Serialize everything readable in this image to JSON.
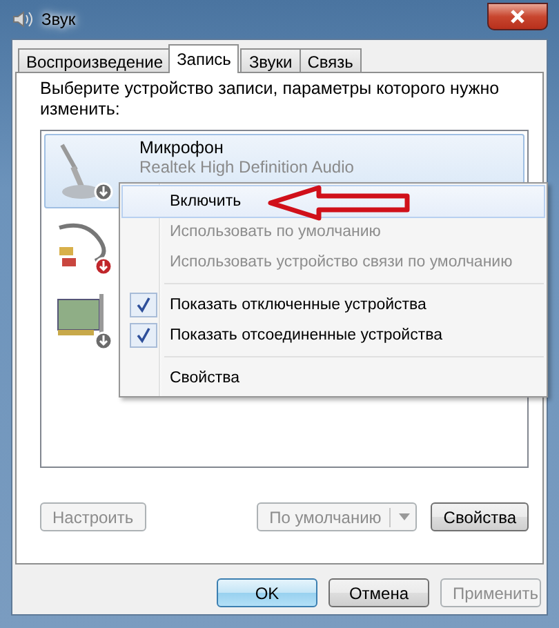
{
  "window": {
    "title": "Звук"
  },
  "tabs": [
    {
      "label": "Воспроизведение",
      "selected": false
    },
    {
      "label": "Запись",
      "selected": true
    },
    {
      "label": "Звуки",
      "selected": false
    },
    {
      "label": "Связь",
      "selected": false
    }
  ],
  "instruction": "Выберите устройство записи, параметры которого нужно изменить:",
  "devices": [
    {
      "kind": "microphone",
      "unplugged": false,
      "name": "Микрофон",
      "driver": "Realtek High Definition Audio",
      "selected": true
    },
    {
      "kind": "cable",
      "unplugged": true,
      "selected": false
    },
    {
      "kind": "card",
      "unplugged": false,
      "selected": false
    }
  ],
  "context_menu": [
    {
      "kind": "item",
      "label": "Включить",
      "disabled": false,
      "checked": false
    },
    {
      "kind": "item",
      "label": "Использовать по умолчанию",
      "disabled": true,
      "checked": false
    },
    {
      "kind": "item",
      "label": "Использовать устройство связи по умолчанию",
      "disabled": true,
      "checked": false
    },
    {
      "kind": "separator"
    },
    {
      "kind": "item",
      "label": "Показать отключенные устройства",
      "disabled": false,
      "checked": true
    },
    {
      "kind": "item",
      "label": "Показать отсоединенные устройства",
      "disabled": false,
      "checked": true
    },
    {
      "kind": "separator"
    },
    {
      "kind": "item",
      "label": "Свойства",
      "disabled": false,
      "checked": false
    }
  ],
  "panel_buttons": {
    "configure": {
      "label": "Настроить",
      "disabled": true
    },
    "default": {
      "label": "По умолчанию",
      "disabled": true
    },
    "properties": {
      "label": "Свойства",
      "disabled": false
    }
  },
  "dialog_buttons": [
    {
      "label": "OK",
      "default": true,
      "disabled": false
    },
    {
      "label": "Отмена",
      "default": false,
      "disabled": false
    },
    {
      "label": "Применить",
      "default": false,
      "disabled": true
    }
  ]
}
